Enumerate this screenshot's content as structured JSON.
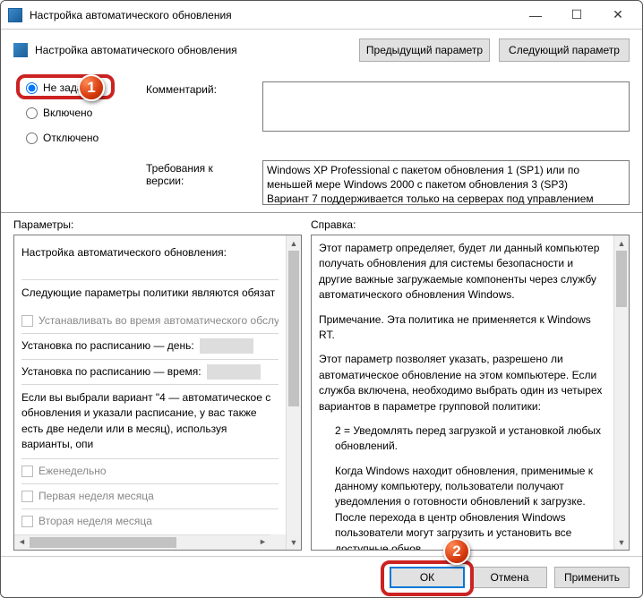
{
  "window": {
    "title": "Настройка автоматического обновления",
    "subtitle": "Настройка автоматического обновления"
  },
  "nav": {
    "prev": "Предыдущий параметр",
    "next": "Следующий параметр"
  },
  "radios": {
    "not_configured": "Не задано",
    "enabled": "Включено",
    "disabled": "Отключено"
  },
  "labels": {
    "comment": "Комментарий:",
    "requirements": "Требования к версии:",
    "options": "Параметры:",
    "help": "Справка:"
  },
  "requirements_text": "Windows XP Professional с пакетом обновления 1 (SP1) или по меньшей мере Windows 2000 с пакетом обновления 3 (SP3)\nВариант 7 поддерживается только на серверах под управлением",
  "options": {
    "title": "Настройка автоматического обновления:",
    "note": "Следующие параметры политики являются обязат",
    "cb1": "Устанавливать во время автоматического обслу",
    "sched_day": "Установка по расписанию — день:",
    "sched_time": "Установка по расписанию — время:",
    "note2": "Если вы выбрали вариант \"4 — автоматическое с обновления и указали расписание, у вас также есть две недели или в месяц), используя варианты, опи",
    "cb2": "Еженедельно",
    "cb3": "Первая неделя месяца",
    "cb4": "Вторая неделя месяца"
  },
  "help": {
    "p1": "Этот параметр определяет, будет ли данный компьютер получать обновления для системы безопасности и другие важные загружаемые компоненты через службу автоматического обновления Windows.",
    "p2": "Примечание. Эта политика не применяется к Windows RT.",
    "p3": "Этот параметр позволяет указать, разрешено ли автоматическое обновление на этом компьютере. Если служба включена, необходимо выбрать один из четырех вариантов в параметре групповой политики:",
    "p4": "2 = Уведомлять перед загрузкой и установкой любых обновлений.",
    "p5": "Когда Windows находит обновления, применимые к данному компьютеру, пользователи получают уведомления о готовности обновлений к загрузке. После перехода в центр обновления Windows пользователи могут загрузить и установить все доступные обнов"
  },
  "buttons": {
    "ok": "ОК",
    "cancel": "Отмена",
    "apply": "Применить"
  },
  "badges": {
    "b1": "1",
    "b2": "2"
  }
}
